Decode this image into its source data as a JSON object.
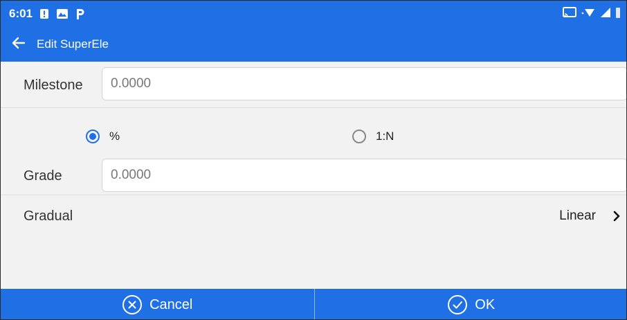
{
  "status_bar": {
    "time": "6:01",
    "notification_icons": [
      "alert-icon",
      "photo-icon",
      "parking-icon"
    ],
    "system_icons": [
      "cast-icon",
      "wifi-icon",
      "signal-icon",
      "battery-icon"
    ]
  },
  "app_bar": {
    "title": "Edit SuperEle",
    "back_icon": "back-arrow-icon"
  },
  "form": {
    "milestone": {
      "label": "Milestone",
      "value": "0.0000"
    },
    "grade_mode": {
      "options": [
        {
          "label": "%",
          "selected": true
        },
        {
          "label": "1:N",
          "selected": false
        }
      ]
    },
    "grade": {
      "label": "Grade",
      "value": "0.0000"
    },
    "gradual": {
      "label": "Gradual",
      "value": "Linear"
    }
  },
  "bottom_bar": {
    "cancel_label": "Cancel",
    "ok_label": "OK"
  },
  "colors": {
    "accent": "#1f6fe5",
    "background": "#f2f2f2"
  }
}
